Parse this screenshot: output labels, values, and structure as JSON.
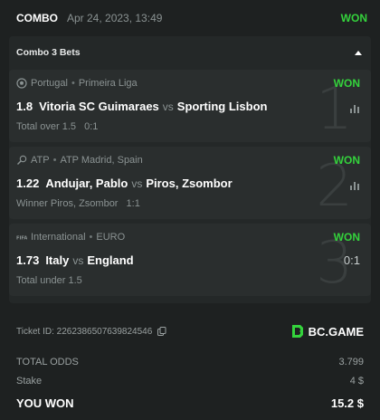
{
  "header": {
    "type": "COMBO",
    "date": "Apr 24, 2023, 13:49",
    "status": "WON"
  },
  "panel": {
    "title": "Combo 3 Bets"
  },
  "bets": [
    {
      "icon": "soccer-ball-icon",
      "country": "Portugal",
      "league": "Primeira Liga",
      "result": "WON",
      "odds": "1.8",
      "home": "Vitoria SC Guimaraes",
      "vs": "vs",
      "away": "Sporting Lisbon",
      "market": "Total over 1.5",
      "score": "0:1",
      "number": "1"
    },
    {
      "icon": "tennis-racket-icon",
      "country": "ATP",
      "league": "ATP Madrid, Spain",
      "result": "WON",
      "odds": "1.22",
      "home": "Andujar, Pablo",
      "vs": "vs",
      "away": "Piros, Zsombor",
      "market": "Winner Piros, Zsombor",
      "score": "1:1",
      "number": "2"
    },
    {
      "icon": "fifa-icon",
      "country": "International",
      "league": "EURO",
      "result": "WON",
      "odds": "1.73",
      "home": "Italy",
      "vs": "vs",
      "away": "England",
      "market": "Total under 1.5",
      "score": "0:1",
      "number": "3"
    }
  ],
  "ticket": {
    "id": "Ticket ID: 226238650763982454​6",
    "brand": "BC.GAME"
  },
  "summary": {
    "total_label": "TOTAL ODDS",
    "total_value": "3.799",
    "stake_label": "Stake",
    "stake_value": "4 $",
    "won_label": "YOU WON",
    "won_value": "15.2 $"
  },
  "colors": {
    "win": "#34d33c",
    "background": "#1e2121",
    "card": "#2a2e2e"
  }
}
